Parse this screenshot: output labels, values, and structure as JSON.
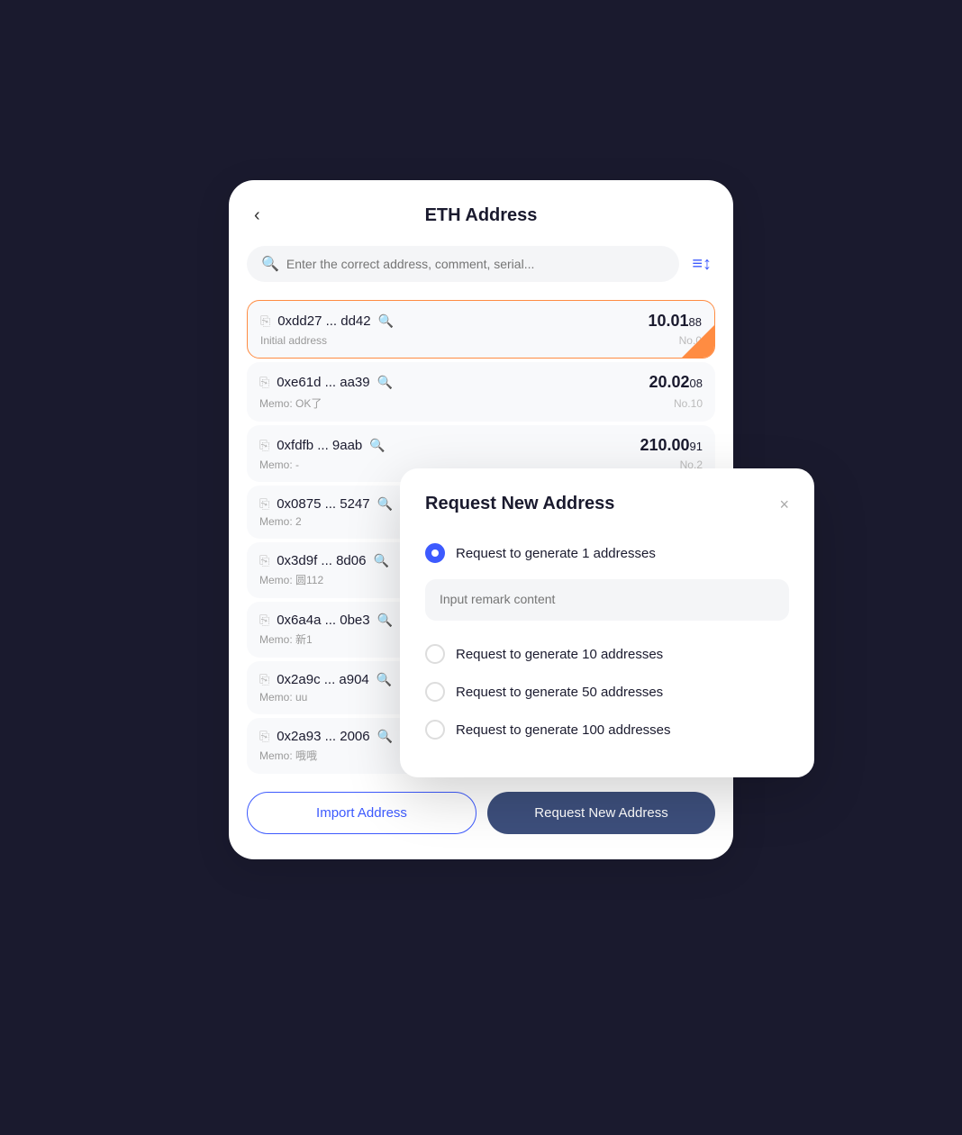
{
  "page": {
    "title": "ETH Address",
    "back_label": "‹"
  },
  "search": {
    "placeholder": "Enter the correct address, comment, serial..."
  },
  "filter_icon": "≡↕",
  "addresses": [
    {
      "address": "0xdd27 ... dd42",
      "memo": "Initial address",
      "amount_main": "10.01",
      "amount_decimal": "88",
      "no": "No.0",
      "active": true
    },
    {
      "address": "0xe61d ... aa39",
      "memo": "Memo: OK了",
      "amount_main": "20.02",
      "amount_decimal": "08",
      "no": "No.10",
      "active": false
    },
    {
      "address": "0xfdfb ... 9aab",
      "memo": "Memo: -",
      "amount_main": "210.00",
      "amount_decimal": "91",
      "no": "No.2",
      "active": false
    },
    {
      "address": "0x0875 ... 5247",
      "memo": "Memo: 2",
      "amount_main": "",
      "amount_decimal": "",
      "no": "",
      "active": false
    },
    {
      "address": "0x3d9f ... 8d06",
      "memo": "Memo: 圆112",
      "amount_main": "",
      "amount_decimal": "",
      "no": "",
      "active": false
    },
    {
      "address": "0x6a4a ... 0be3",
      "memo": "Memo: 新1",
      "amount_main": "",
      "amount_decimal": "",
      "no": "",
      "active": false
    },
    {
      "address": "0x2a9c ... a904",
      "memo": "Memo: uu",
      "amount_main": "",
      "amount_decimal": "",
      "no": "",
      "active": false
    },
    {
      "address": "0x2a93 ... 2006",
      "memo": "Memo: 哦哦",
      "amount_main": "",
      "amount_decimal": "",
      "no": "",
      "active": false
    }
  ],
  "buttons": {
    "import": "Import Address",
    "request": "Request New Address"
  },
  "modal": {
    "title": "Request New Address",
    "close": "×",
    "remark_placeholder": "Input remark content",
    "options": [
      {
        "label": "Request to generate 1 addresses",
        "checked": true
      },
      {
        "label": "Request to generate 10 addresses",
        "checked": false
      },
      {
        "label": "Request to generate 50 addresses",
        "checked": false
      },
      {
        "label": "Request to generate 100 addresses",
        "checked": false
      }
    ]
  }
}
